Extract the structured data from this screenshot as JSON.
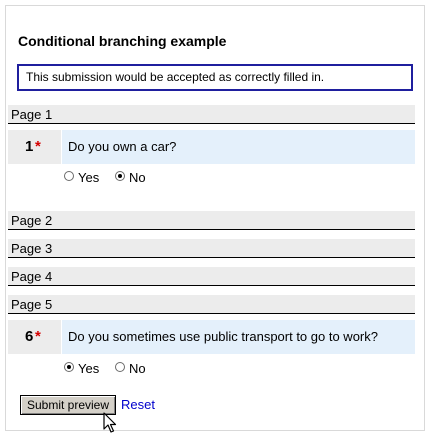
{
  "form": {
    "title": "Conditional branching example",
    "notice": "This submission would be accepted as correctly filled in."
  },
  "pages": {
    "page1": "Page 1",
    "page2": "Page 2",
    "page3": "Page 3",
    "page4": "Page 4",
    "page5": "Page 5"
  },
  "questions": [
    {
      "number": "1",
      "required_mark": "*",
      "text": "Do you own a car?",
      "options": [
        "Yes",
        "No"
      ],
      "selected": "No"
    },
    {
      "number": "6",
      "required_mark": "*",
      "text": "Do you sometimes use public transport to go to work?",
      "options": [
        "Yes",
        "No"
      ],
      "selected": "Yes"
    }
  ],
  "actions": {
    "submit_label": "Submit preview",
    "reset_label": "Reset"
  },
  "colors": {
    "notice_border": "#1f1f9e",
    "required": "#d40000",
    "question_bg": "#e4f0fb",
    "link": "#0000cc"
  }
}
